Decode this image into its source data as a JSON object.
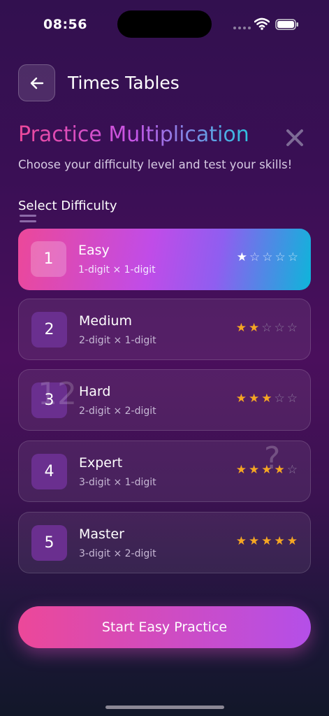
{
  "status_bar": {
    "time": "08:56"
  },
  "header": {
    "title": "Times Tables",
    "back_icon": "arrow-left-icon"
  },
  "hero": {
    "title": "Practice Multiplication",
    "subtitle": "Choose your difficulty level and test your skills!",
    "close_icon": "close-icon"
  },
  "section": {
    "label": "Select Difficulty"
  },
  "levels": [
    {
      "number": "1",
      "name": "Easy",
      "description": "1-digit × 1-digit",
      "stars": 1,
      "max_stars": 5,
      "selected": true
    },
    {
      "number": "2",
      "name": "Medium",
      "description": "2-digit × 1-digit",
      "stars": 2,
      "max_stars": 5,
      "selected": false
    },
    {
      "number": "3",
      "name": "Hard",
      "description": "2-digit × 2-digit",
      "stars": 3,
      "max_stars": 5,
      "selected": false
    },
    {
      "number": "4",
      "name": "Expert",
      "description": "3-digit × 1-digit",
      "stars": 4,
      "max_stars": 5,
      "selected": false
    },
    {
      "number": "5",
      "name": "Master",
      "description": "3-digit × 2-digit",
      "stars": 5,
      "max_stars": 5,
      "selected": false
    }
  ],
  "decorations": {
    "number": "12",
    "question_mark": "?"
  },
  "cta": {
    "label": "Start Easy Practice"
  },
  "colors": {
    "accent_pink": "#ec4899",
    "accent_purple": "#b44fe8",
    "accent_cyan": "#0eb5da",
    "star": "#f5a623"
  }
}
